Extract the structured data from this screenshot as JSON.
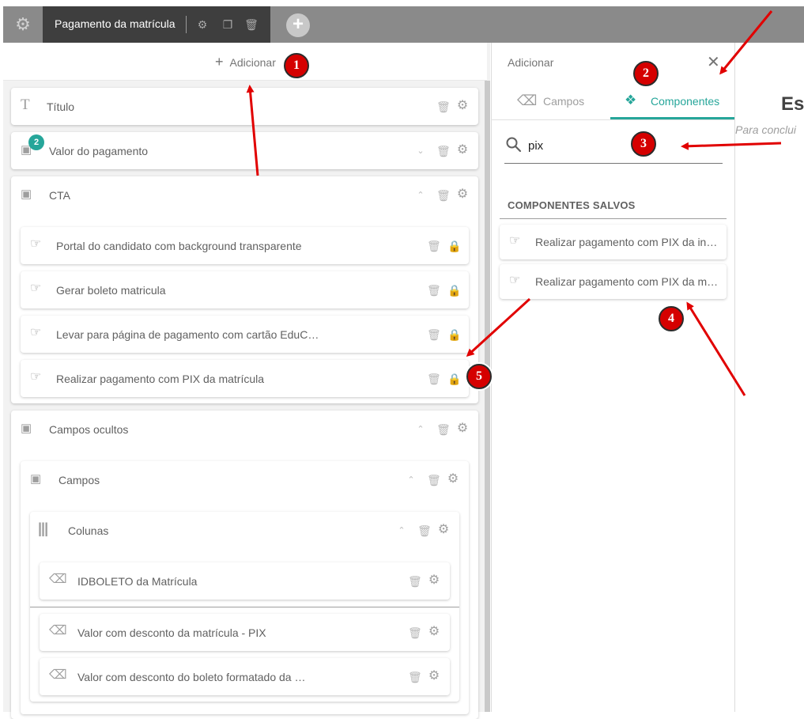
{
  "topbar": {
    "tab_title": "Pagamento da matrícula",
    "icons": [
      "settings-icon",
      "gear-icon",
      "copy-icon",
      "trash-icon",
      "plus-icon"
    ]
  },
  "editor": {
    "add_label": "Adicionar",
    "items": {
      "titulo": "Título",
      "valor_pagamento": "Valor do pagamento",
      "valor_pagamento_badge": "2",
      "cta": "CTA",
      "cta_children": [
        "Portal do candidato com background transparente",
        "Gerar boleto matricula",
        "Levar para página de pagamento com cartão EduC…",
        "Realizar pagamento com PIX da matrícula"
      ],
      "campos_ocultos": "Campos ocultos",
      "campos": "Campos",
      "colunas": "Colunas",
      "fields": [
        "IDBOLETO da Matrícula",
        "Valor com desconto da matrícula - PIX",
        "Valor com desconto do boleto formatado da …"
      ]
    }
  },
  "drawer": {
    "title": "Adicionar",
    "tabs": [
      {
        "label": "Campos",
        "active": false
      },
      {
        "label": "Componentes",
        "active": true
      }
    ],
    "search_value": "pix",
    "saved_header": "COMPONENTES SALVOS",
    "saved_items": [
      "Realizar pagamento com PIX da in…",
      "Realizar pagamento com PIX da m…"
    ]
  },
  "page": {
    "heading": "Es",
    "subtitle": "Para conclui"
  },
  "annotations": {
    "markers": [
      "1",
      "2",
      "3",
      "4",
      "5"
    ],
    "color": "#e10000"
  },
  "colors": {
    "accent": "#26a69a",
    "topbar": "#8a8a8a",
    "active_tab": "#3e3e3e",
    "marker": "#d50000"
  }
}
